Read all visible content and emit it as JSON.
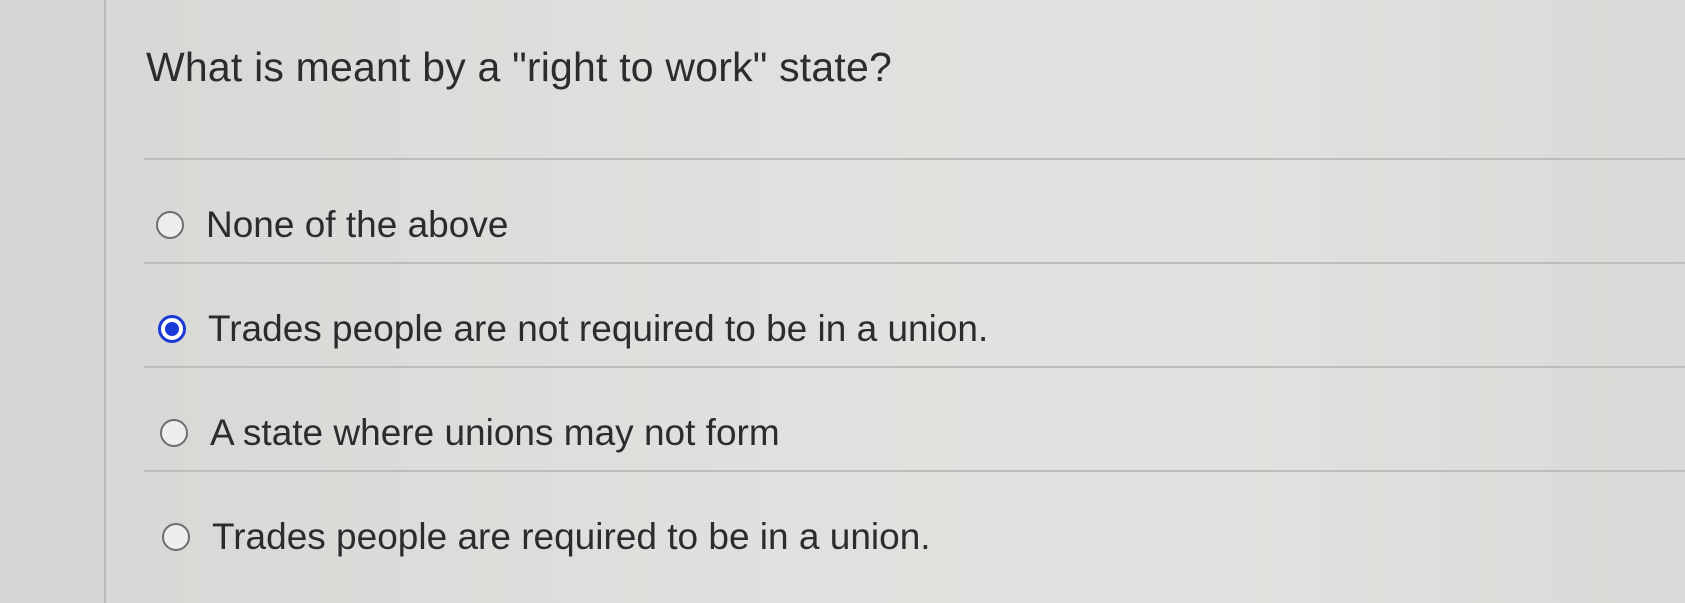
{
  "question": {
    "text": "What is meant by a \"right to work\" state?"
  },
  "answers": [
    {
      "label": "None of the above",
      "selected": false
    },
    {
      "label": "Trades people are not required to be in a union.",
      "selected": true
    },
    {
      "label": "A state where unions may not form",
      "selected": false
    },
    {
      "label": "Trades people are required to be in a union.",
      "selected": false
    }
  ],
  "colors": {
    "selected_radio": "#1a39d6",
    "text": "#2b2c2e",
    "background": "#dcdcd9"
  }
}
